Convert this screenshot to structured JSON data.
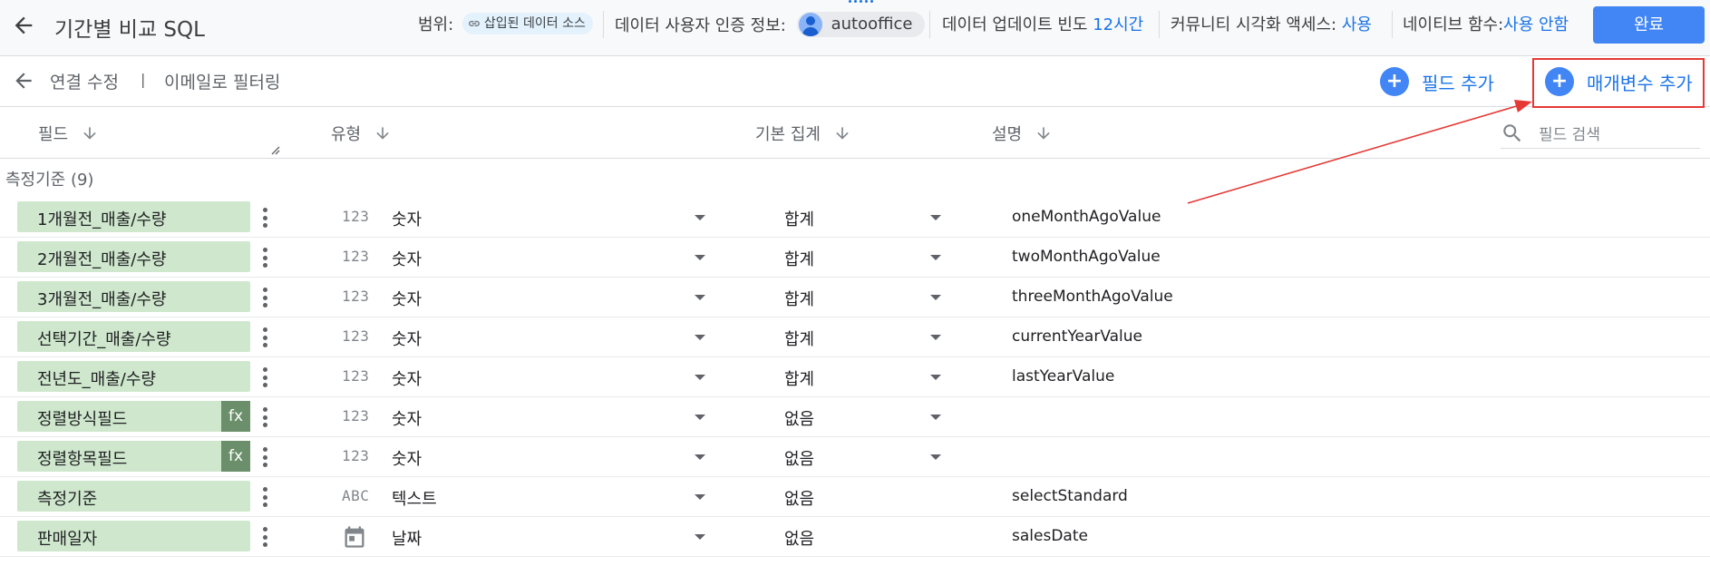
{
  "header": {
    "title": "기간별 비교 SQL",
    "scope_label": "범위:",
    "scope_chip": "삽입된 데이터 소스",
    "credentials_label": "데이터 사용자 인증 정보:",
    "credentials_user": "autooffice",
    "freshness_label": "데이터 업데이트 빈도",
    "freshness_value": "12시간",
    "community_label": "커뮤니티 시각화 액세스:",
    "community_value": "사용",
    "native_label": "네이티브 함수:",
    "native_value": "사용 안함",
    "done_label": "완료"
  },
  "subheader": {
    "edit_connection": "연결 수정",
    "separator": "|",
    "filter_by_email": "이메일로 필터링",
    "add_field": "필드 추가",
    "add_parameter": "매개변수 추가"
  },
  "columns": {
    "field": "필드",
    "type": "유형",
    "aggregation": "기본 집계",
    "description": "설명",
    "search_placeholder": "필드 검색"
  },
  "section": {
    "label": "측정기준 (9)"
  },
  "rows": [
    {
      "name": "1개월전_매출/수량",
      "type_icon": "123",
      "type": "숫자",
      "agg": "합계",
      "desc": "oneMonthAgoValue"
    },
    {
      "name": "2개월전_매출/수량",
      "type_icon": "123",
      "type": "숫자",
      "agg": "합계",
      "desc": "twoMonthAgoValue"
    },
    {
      "name": "3개월전_매출/수량",
      "type_icon": "123",
      "type": "숫자",
      "agg": "합계",
      "desc": "threeMonthAgoValue"
    },
    {
      "name": "선택기간_매출/수량",
      "type_icon": "123",
      "type": "숫자",
      "agg": "합계",
      "desc": "currentYearValue"
    },
    {
      "name": "전년도_매출/수량",
      "type_icon": "123",
      "type": "숫자",
      "agg": "합계",
      "desc": "lastYearValue"
    },
    {
      "name": "정렬방식필드",
      "type_icon": "123",
      "type": "숫자",
      "agg": "없음",
      "desc": "",
      "fx": "fx"
    },
    {
      "name": "정렬항목필드",
      "type_icon": "123",
      "type": "숫자",
      "agg": "없음",
      "desc": "",
      "fx": "fx"
    },
    {
      "name": "측정기준",
      "type_icon": "ABC",
      "type": "텍스트",
      "agg": "없음",
      "desc": "selectStandard"
    },
    {
      "name": "판매일자",
      "type_icon": "calendar-icon",
      "type": "날짜",
      "agg": "없음",
      "desc": "salesDate"
    }
  ],
  "colors": {
    "accent": "#1a73e8",
    "button": "#4285f4",
    "field_pill": "#cfe8cd",
    "fx_badge": "#6b8f6a",
    "annotation_red": "#e53935"
  }
}
